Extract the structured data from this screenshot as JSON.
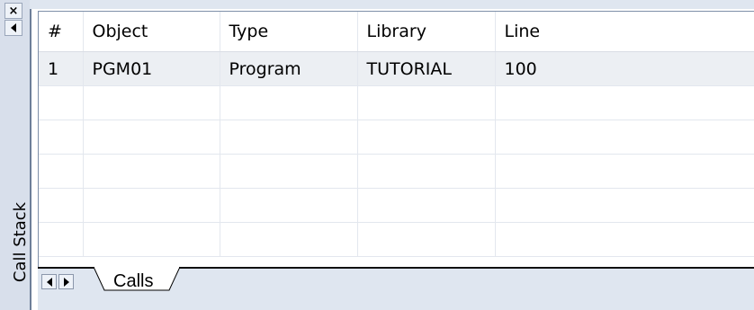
{
  "panel": {
    "title": "Call Stack",
    "close_glyph": "×"
  },
  "table": {
    "columns": [
      "#",
      "Object",
      "Type",
      "Library",
      "Line"
    ],
    "rows": [
      {
        "num": "1",
        "object": "PGM01",
        "type": "Program",
        "library": "TUTORIAL",
        "line": "100"
      }
    ]
  },
  "tabs": {
    "active": "Calls"
  },
  "icons": {
    "close": "close-icon",
    "dock_left": "arrow-left-icon",
    "tab_prev": "tab-prev-icon",
    "tab_next": "tab-next-icon"
  }
}
